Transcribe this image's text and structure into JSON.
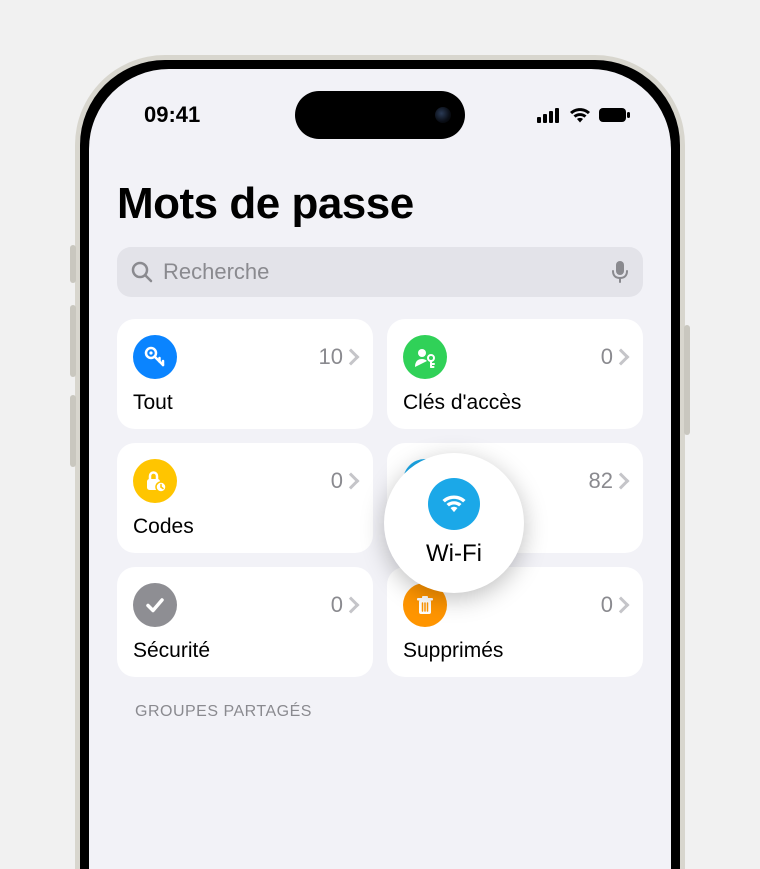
{
  "status": {
    "time": "09:41"
  },
  "page": {
    "title": "Mots de passe"
  },
  "search": {
    "placeholder": "Recherche"
  },
  "cards": {
    "all": {
      "label": "Tout",
      "count": "10"
    },
    "passkeys": {
      "label": "Clés d'accès",
      "count": "0"
    },
    "codes": {
      "label": "Codes",
      "count": "0"
    },
    "wifi": {
      "label": "Wi-Fi",
      "count": "82"
    },
    "security": {
      "label": "Sécurité",
      "count": "0"
    },
    "deleted": {
      "label": "Supprimés",
      "count": "0"
    }
  },
  "highlight": {
    "label": "Wi-Fi"
  },
  "sections": {
    "shared_groups": "GROUPES PARTAGÉS"
  },
  "colors": {
    "blue": "#0a84ff",
    "green": "#30d158",
    "yellow": "#ffc500",
    "skyblue": "#1ba8e8",
    "gray": "#8e8e93",
    "orange": "#ff9500"
  }
}
